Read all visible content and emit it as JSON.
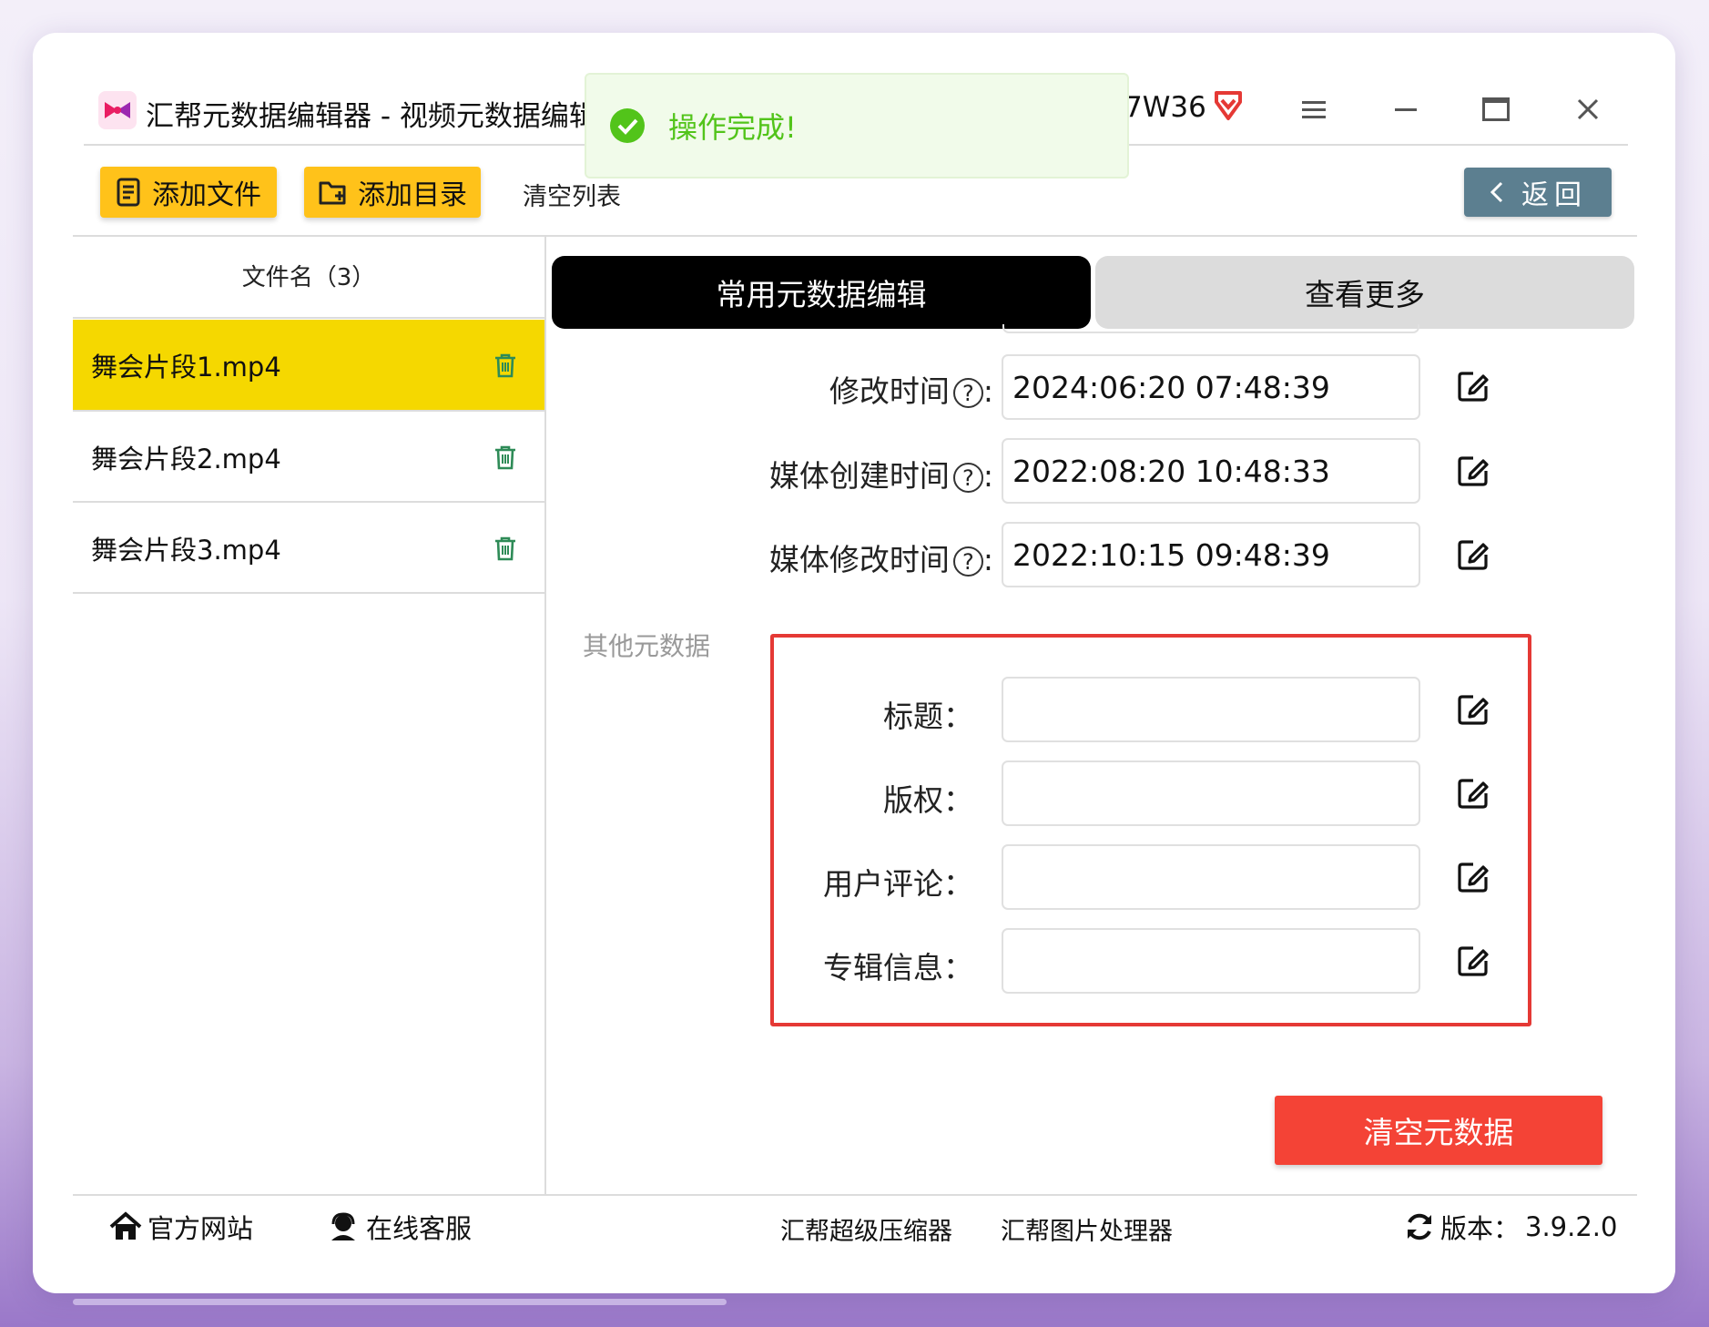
{
  "titlebar": {
    "app_title": "汇帮元数据编辑器 - 视频元数据编辑",
    "account_fragment": "7W36",
    "menu_icon": "hamburger-menu-icon",
    "minimize_icon": "minimize-icon",
    "maximize_icon": "maximize-icon",
    "close_icon": "close-icon",
    "vip_icon": "red-diamond-icon"
  },
  "toast": {
    "message": "操作完成!",
    "icon": "check-circle-icon",
    "color": "#52c41a"
  },
  "toolbar": {
    "add_file_label": "添加文件",
    "add_folder_label": "添加目录",
    "clear_list_label": "清空列表",
    "back_label": "返回"
  },
  "file_list": {
    "header": "文件名（3）",
    "items": [
      {
        "name": "舞会片段1.mp4",
        "selected": true
      },
      {
        "name": "舞会片段2.mp4",
        "selected": false
      },
      {
        "name": "舞会片段3.mp4",
        "selected": false
      }
    ]
  },
  "tabs": {
    "active": "常用元数据编辑",
    "inactive": "查看更多"
  },
  "time_fields": [
    {
      "label": "修改时间",
      "value": "2024:06:20 07:48:39"
    },
    {
      "label": "媒体创建时间",
      "value": "2022:08:20 10:48:33"
    },
    {
      "label": "媒体修改时间",
      "value": "2022:10:15 09:48:39"
    }
  ],
  "other_section": {
    "title": "其他元数据",
    "fields": [
      {
        "label": "标题：",
        "value": ""
      },
      {
        "label": "版权：",
        "value": ""
      },
      {
        "label": "用户评论：",
        "value": ""
      },
      {
        "label": "专辑信息：",
        "value": ""
      }
    ]
  },
  "clear_button_label": "清空元数据",
  "footer": {
    "website_label": "官方网站",
    "support_label": "在线客服",
    "compressor_label": "汇帮超级压缩器",
    "image_tool_label": "汇帮图片处理器",
    "version_label": "版本：",
    "version_value": "3.9.2.0"
  },
  "colors": {
    "accent_yellow": "#ffc21a",
    "selected_row": "#f5d800",
    "highlight_box": "#e53935",
    "clear_button": "#f44336",
    "back_button": "#5c7f90",
    "trash_icon": "#2e8b57"
  }
}
